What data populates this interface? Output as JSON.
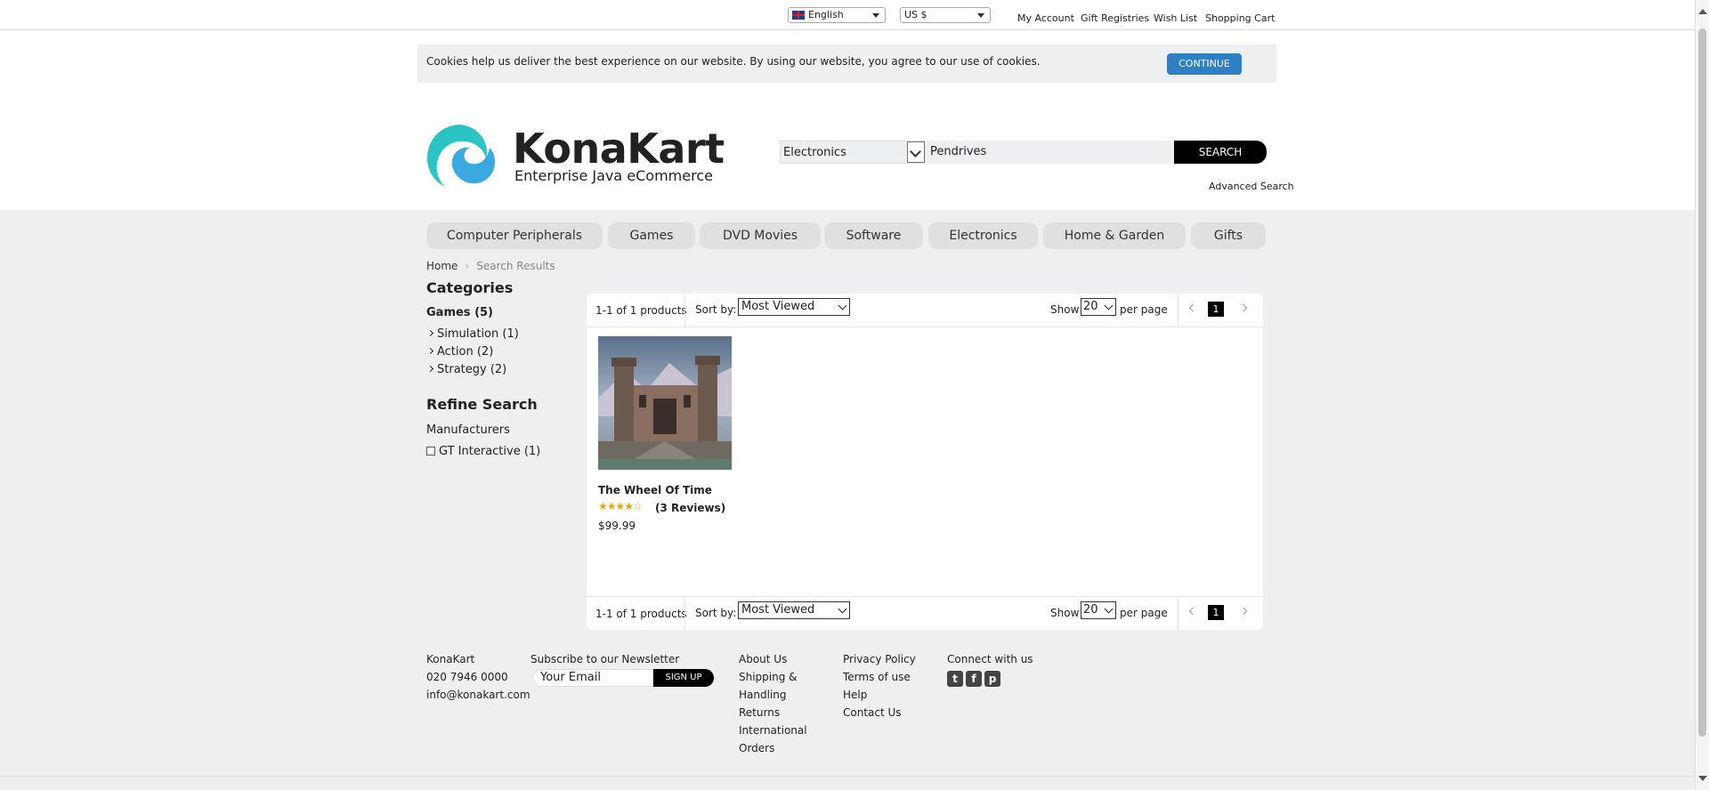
{
  "topbar": {
    "language": "English",
    "currency": "US $",
    "links": [
      "My Account",
      "Gift Registries",
      "Wish List",
      "Shopping Cart"
    ]
  },
  "cookie": {
    "message": "Cookies help us deliver the best experience on our website. By using our website, you agree to our use of cookies.",
    "button": "CONTINUE"
  },
  "logo": {
    "name": "KonaKart",
    "tagline": "Enterprise Java eCommerce"
  },
  "search": {
    "category": "Electronics",
    "query": "Pendrives",
    "button": "SEARCH",
    "advanced": "Advanced Search"
  },
  "nav": [
    "Computer Peripherals",
    "Games",
    "DVD Movies",
    "Software",
    "Electronics",
    "Home & Garden",
    "Gifts"
  ],
  "breadcrumb": {
    "home": "Home",
    "current": "Search Results"
  },
  "sidebar": {
    "categories_title": "Categories",
    "parent": "Games (5)",
    "children": [
      "Simulation (1)",
      "Action (2)",
      "Strategy (2)"
    ],
    "refine_title": "Refine Search",
    "manufacturers_title": "Manufacturers",
    "manufacturers": [
      "GT Interactive (1)"
    ]
  },
  "results": {
    "count": "1-1 of 1 products",
    "sort_label": "Sort by:",
    "sort_value": "Most Viewed",
    "show_label": "Show",
    "show_value": "20",
    "per_page": "per page",
    "page": "1"
  },
  "product": {
    "title": "The Wheel Of Time",
    "rating": 4,
    "rating_max": 5,
    "reviews": "(3 Reviews)",
    "price": "$99.99"
  },
  "footer": {
    "company": "KonaKart",
    "phone": "020 7946 0000",
    "email": "info@konakart.com",
    "newsletter_title": "Subscribe to our Newsletter",
    "newsletter_placeholder": "Your Email",
    "signup": "SIGN UP",
    "col1": [
      "About Us",
      "Shipping &",
      "Handling",
      "Returns",
      "International",
      "Orders"
    ],
    "col2": [
      "Privacy Policy",
      "Terms of use",
      "Help",
      "Contact Us"
    ],
    "connect": "Connect with us",
    "social_icons": [
      "twitter-icon",
      "facebook-icon",
      "pinterest-icon"
    ]
  },
  "colors": {
    "accent": "#2f7fc4",
    "logo_teal": "#2bc4c4",
    "logo_blue": "#3aa9e0",
    "star": "#f2a413",
    "background": "#eeeff0"
  }
}
